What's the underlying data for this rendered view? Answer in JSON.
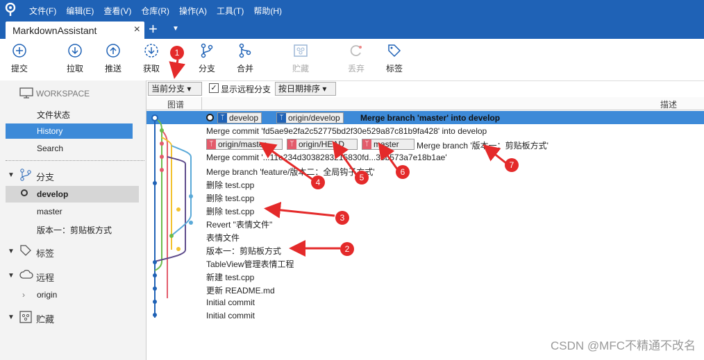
{
  "menubar": {
    "items": [
      "文件(F)",
      "编辑(E)",
      "查看(V)",
      "仓库(R)",
      "操作(A)",
      "工具(T)",
      "帮助(H)"
    ]
  },
  "tabbar": {
    "tab_title": "MarkdownAssistant",
    "close": "×",
    "plus": "+",
    "dropdown": "▼"
  },
  "toolbar": {
    "commit": "提交",
    "pull": "拉取",
    "push": "推送",
    "fetch": "获取",
    "branch": "分支",
    "merge": "合并",
    "stash": "贮藏",
    "discard": "丢弃",
    "tag": "标签"
  },
  "sidebar": {
    "workspace": "WORKSPACE",
    "file_status": "文件状态",
    "history": "History",
    "search": "Search",
    "branches_header": "分支",
    "branches": [
      "develop",
      "master",
      "版本一：剪贴板方式"
    ],
    "tags_header": "标签",
    "remotes_header": "远程",
    "remotes": [
      "origin"
    ],
    "stashes_header": "贮藏"
  },
  "filters": {
    "current_branch": "当前分支 ▾",
    "show_remote": "显示远程分支",
    "sort": "按日期排序 ▾"
  },
  "columns": {
    "graph": "图谱",
    "description": "描述"
  },
  "commits": [
    {
      "tags": [
        "develop",
        "origin/develop"
      ],
      "message": "Merge branch 'master' into develop"
    },
    {
      "message": "Merge commit 'fd5ae9e2fa2c52775bd2f30e529a87c81b9fa428' into develop"
    },
    {
      "tags": [
        "origin/master",
        "origin/HEAD",
        "master"
      ],
      "message": "Merge branch '版本一：剪贴板方式'"
    },
    {
      "message": "Merge commit '...11e234d3038283215830fd...35b573a7e18b1ae'"
    },
    {
      "message": "Merge branch 'feature/版本二：全局钩子方式'"
    },
    {
      "message": "删除 test.cpp"
    },
    {
      "message": "删除 test.cpp"
    },
    {
      "message": "删除 test.cpp"
    },
    {
      "message": "Revert \"表情文件\""
    },
    {
      "message": "表情文件"
    },
    {
      "message": "版本一：剪贴板方式"
    },
    {
      "message": "TableView管理表情工程"
    },
    {
      "message": "新建 test.cpp"
    },
    {
      "message": "更新 README.md"
    },
    {
      "message": "Initial commit"
    },
    {
      "message": "Initial commit"
    }
  ],
  "markers": [
    "1",
    "2",
    "3",
    "4",
    "5",
    "6",
    "7"
  ],
  "watermark": "CSDN @MFC不精通不改名",
  "colors": {
    "accent": "#1f62b6",
    "selected": "#3d8ad8",
    "marker": "#e42a2a"
  }
}
